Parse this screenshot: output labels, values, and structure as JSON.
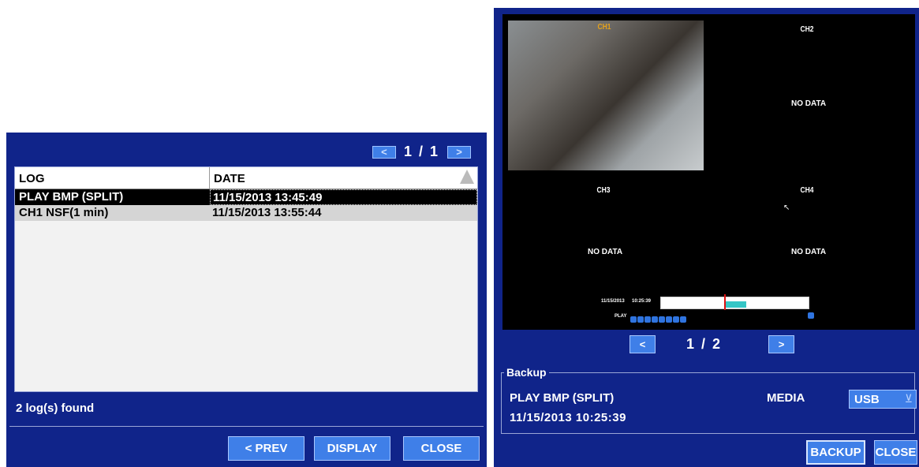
{
  "log_dialog": {
    "pager": {
      "prev_icon": "<",
      "text": "1 / 1",
      "next_icon": ">"
    },
    "columns": {
      "log": "LOG",
      "date": "DATE"
    },
    "rows": [
      {
        "log": "PLAY BMP (SPLIT)",
        "date": "11/15/2013 13:45:49"
      },
      {
        "log": "CH1 NSF(1 min)",
        "date": "11/15/2013 13:55:44"
      }
    ],
    "status": "2 log(s) found",
    "buttons": {
      "prev": "< PREV",
      "display": "DISPLAY",
      "close": "CLOSE"
    }
  },
  "playback_dialog": {
    "channels": {
      "ch1": "CH1",
      "ch2": "CH2",
      "ch3": "CH3",
      "ch4": "CH4"
    },
    "no_data": "NO DATA",
    "timeline": {
      "date": "11/15/2013",
      "time": "10:25:39",
      "play_label": "PLAY",
      "progress_fraction": 0.44
    },
    "pager": {
      "prev_label": "<",
      "text": "1 / 2",
      "next_label": ">"
    },
    "backup": {
      "legend": "Backup",
      "item": "PLAY BMP (SPLIT)",
      "timestamp": "11/15/2013 10:25:39",
      "media_label": "MEDIA",
      "media_value": "USB"
    },
    "buttons": {
      "backup": "BACKUP",
      "close": "CLOSE"
    }
  },
  "colors": {
    "panel": "#10248a",
    "button": "#3f7fe8",
    "video_bg": "#000000"
  }
}
